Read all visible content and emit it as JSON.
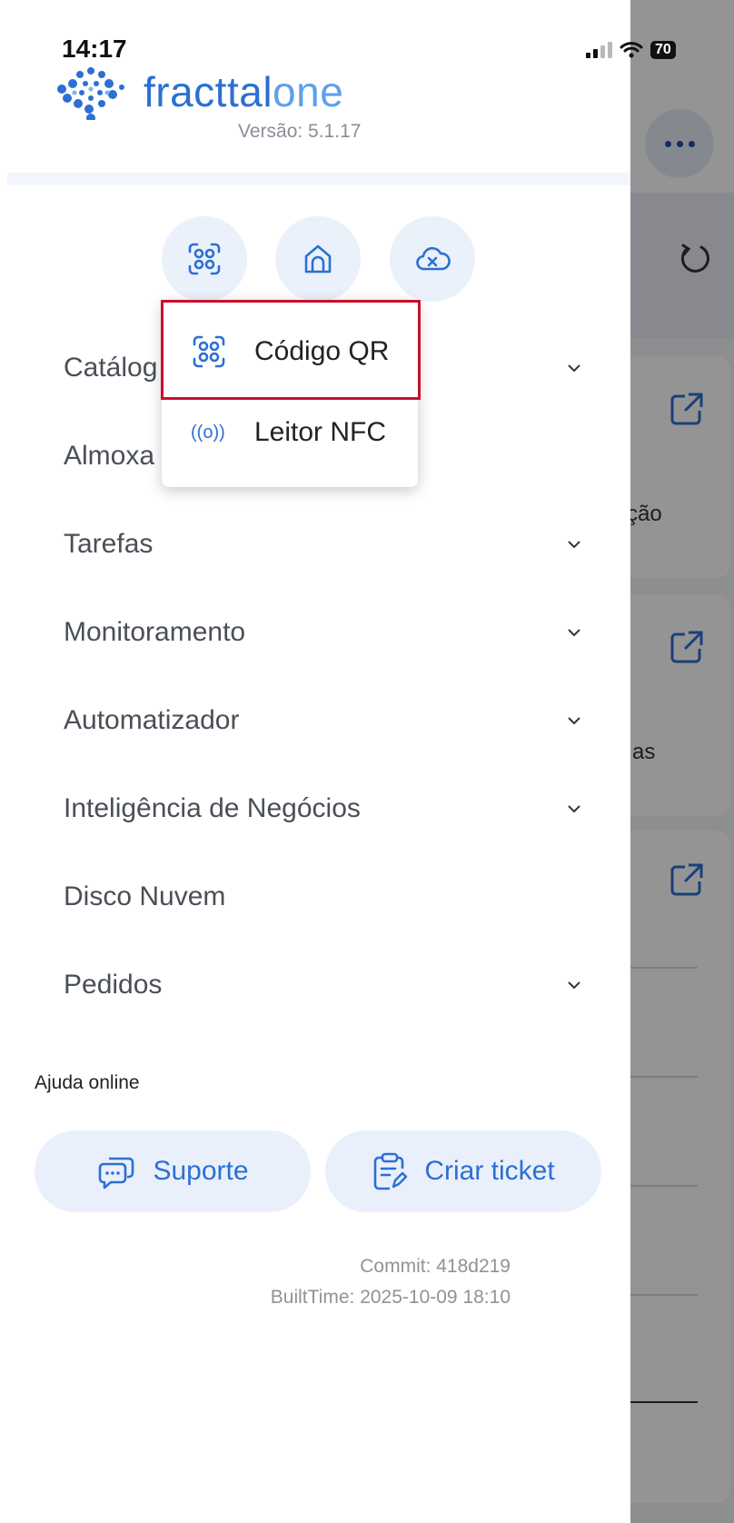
{
  "status_bar": {
    "time": "14:17",
    "battery": "70"
  },
  "app": {
    "brand_prefix": "fracttal",
    "brand_suffix": "one",
    "version": "Versão: 5.1.17"
  },
  "toolbar": {
    "buttons": [
      {
        "name": "scan",
        "icon": "qr-scan-icon"
      },
      {
        "name": "home",
        "icon": "home-icon"
      },
      {
        "name": "offline",
        "icon": "cloud-off-icon"
      }
    ]
  },
  "scan_menu": {
    "items": [
      {
        "label": "Código QR",
        "icon": "qr-scan-icon"
      },
      {
        "label": "Leitor NFC",
        "icon": "nfc-icon",
        "icon_text": "((o))"
      }
    ]
  },
  "menu": {
    "items": [
      {
        "label": "Catálogos",
        "visible_label": "Catálog",
        "has_chevron": true
      },
      {
        "label": "Almoxarifado",
        "visible_label": "Almoxa",
        "has_chevron": false
      },
      {
        "label": "Tarefas",
        "has_chevron": true
      },
      {
        "label": "Monitoramento",
        "has_chevron": true
      },
      {
        "label": "Automatizador",
        "has_chevron": true
      },
      {
        "label": "Inteligência de Negócios",
        "has_chevron": true
      },
      {
        "label": "Disco Nuvem",
        "has_chevron": false
      },
      {
        "label": "Pedidos",
        "has_chevron": true
      }
    ]
  },
  "help": {
    "title": "Ajuda online",
    "support_label": "Suporte",
    "ticket_label": "Criar ticket"
  },
  "build": {
    "commit": "Commit: 418d219",
    "built_time": "BuiltTime: 2025-10-09 18:10"
  },
  "background": {
    "text_1": "ção",
    "text_2": "as"
  },
  "colors": {
    "accent": "#2d6fd3",
    "highlight_border": "#c8102e",
    "pill_bg": "#e9f0fb"
  }
}
